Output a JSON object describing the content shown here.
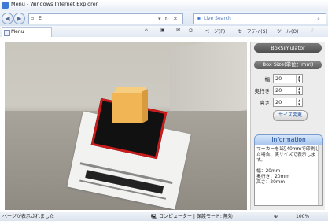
{
  "window": {
    "title": "Menu - Windows Internet Explorer"
  },
  "nav": {
    "back_icon": "back-arrow-icon",
    "forward_icon": "forward-arrow-icon",
    "address_value": "E:",
    "search_placeholder": "Live Search"
  },
  "tab": {
    "label": "Menu"
  },
  "command_bar": {
    "page": "ページ(P)",
    "safety": "セーフティ(S)",
    "tools": "ツール(O)",
    "help": "❔"
  },
  "panel": {
    "title": "BoxSimulator",
    "size_header": "Box Size(単位：mm)",
    "fields": [
      {
        "label": "幅",
        "value": "20"
      },
      {
        "label": "奥行き",
        "value": "20"
      },
      {
        "label": "高さ",
        "value": "20"
      }
    ],
    "apply_label": "サイズ変更",
    "info_title": "Information",
    "info_text": "マーカーを1辺40mmで印刷した場合、実サイズで表示します。\n\n幅：20mm\n奥行き：20mm\n高さ：20mm"
  },
  "status": {
    "left_text": "ページが表示されました",
    "zone_text": "コンピューター | 保護モード: 無効",
    "zoom": "100%"
  },
  "colors": {
    "marker_border": "#c91d1d",
    "cube": "#f1b555",
    "info_title": "#0b3e8d"
  }
}
